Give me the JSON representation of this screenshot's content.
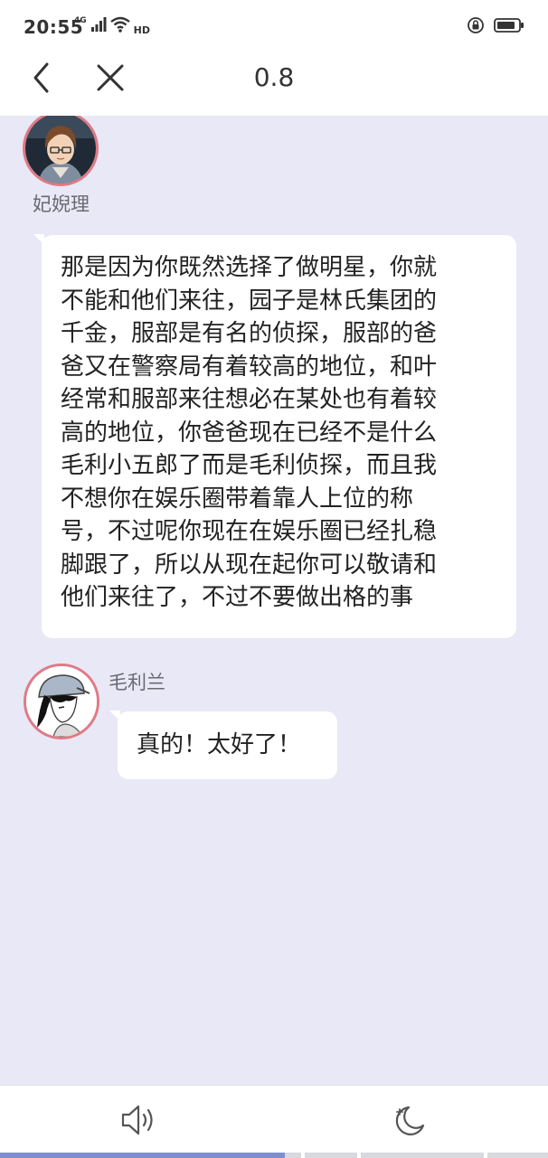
{
  "status_bar": {
    "time": "20:55",
    "network": "4G",
    "hd": "HD",
    "icons": [
      "signal-icon",
      "wifi-icon",
      "lock-rotation-icon",
      "battery-icon"
    ]
  },
  "header": {
    "title": "0.8",
    "icons": [
      "back-chevron-icon",
      "close-icon"
    ]
  },
  "messages": [
    {
      "sender": "妃婗理",
      "lines": [
        "那是因为你既然选择了做明星，你就",
        "不能和他们来往，园子是林氏集团的",
        "千金，服部是有名的侦探，服部的爸",
        "爸又在警察局有着较高的地位，和叶",
        "经常和服部来往想必在某处也有着较",
        "高的地位，你爸爸现在已经不是什么",
        "毛利小五郎了而是毛利侦探，而且我",
        "不想你在娱乐圈带着靠人上位的称",
        "号，不过呢你现在在娱乐圈已经扎稳",
        "脚跟了，所以从现在起你可以敬请和",
        "他们来往了，不过不要做出格的事"
      ]
    },
    {
      "sender": "毛利兰",
      "lines": [
        "真的！太好了！"
      ]
    }
  ],
  "bottom_bar": {
    "icons": [
      "speaker-icon",
      "night-mode-icon"
    ]
  },
  "progress": {
    "fraction": 0.52
  },
  "colors": {
    "chat_background": "#e8e8f6",
    "avatar_border": "#e07a85",
    "bubble": "#ffffff",
    "progress_fill": "#7d8fcf",
    "progress_track": "#d9d9e0"
  }
}
